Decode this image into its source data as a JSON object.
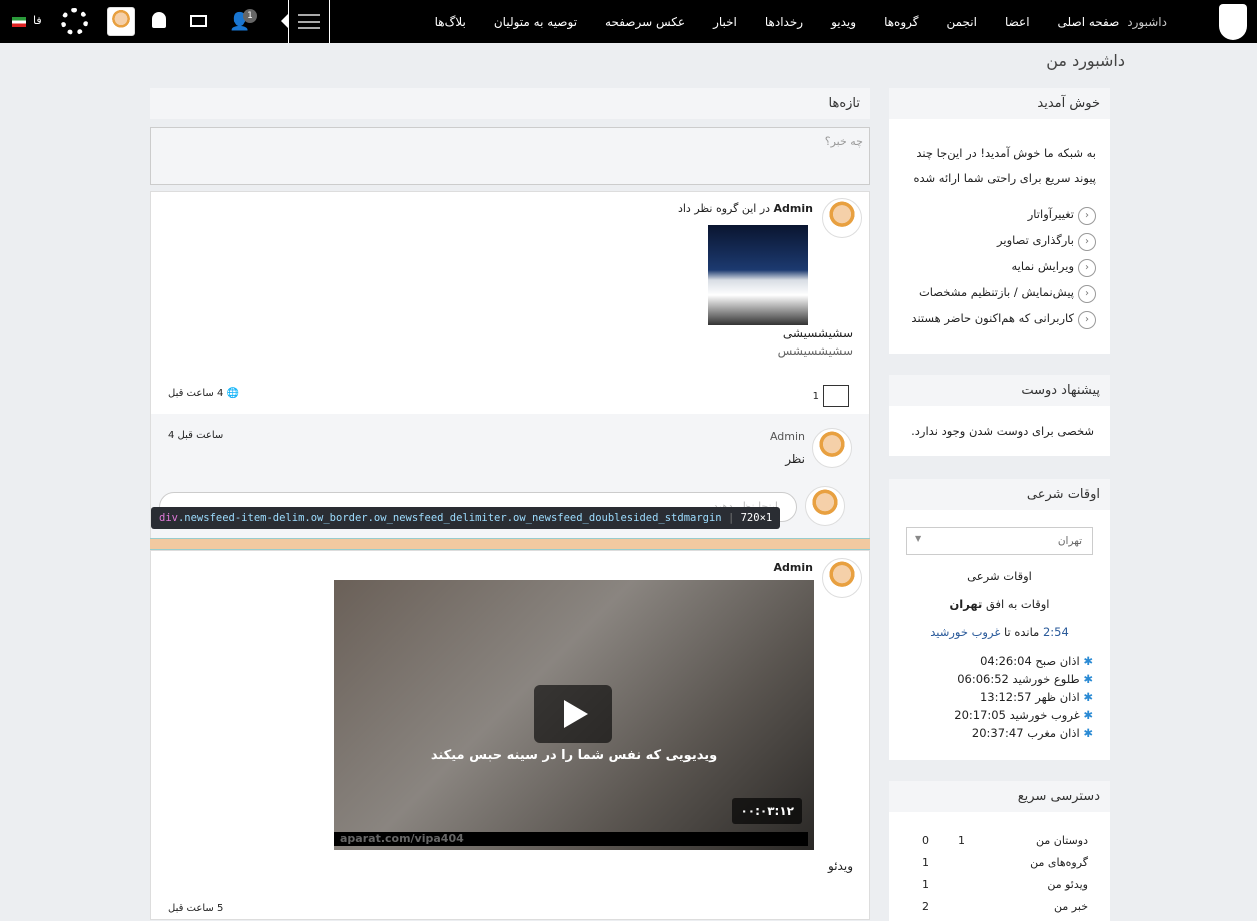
{
  "topbar": {
    "logo": "logo-icon",
    "nav": [
      "داشبورد",
      "صفحه اصلی",
      "اعضا",
      "انجمن",
      "گروه‌ها",
      "ویدیو",
      "رخدادها",
      "اخبار",
      "عکس سرصفحه",
      "توصیه به متولیان",
      "بلاگ‌ها"
    ],
    "friend_requests_count": "1",
    "lang": "فا"
  },
  "page_title": "داشبورد من",
  "feed": {
    "header": "تازه‌ها",
    "status_placeholder": "چه خبر؟",
    "post1": {
      "author": "Admin",
      "action": "در این گروه نظر داد",
      "line1": "سشیشسیشی",
      "line2": "سشیشسیشس",
      "comment_count": "1",
      "time": "4 ساعت قبل",
      "comment": {
        "author": "Admin",
        "text": "نظر",
        "time": "4 ساعت قبل"
      },
      "comment_placeholder": "اینجا نظر دهید"
    },
    "devtools_tooltip": {
      "tag": "div",
      "classes": ".newsfeed-item-delim.ow_border.ow_newsfeed_delimiter.ow_newsfeed_doublesided_stdmargin",
      "size": "720×1"
    },
    "post2": {
      "author": "Admin",
      "video_caption": "ویدیویی که نفس شما را در سینه حبس میکند",
      "duration": "۰۰:۰۳:۱۲",
      "watermark": "aparat.com/vipa404",
      "text": "ویدئو",
      "time": "5 ساعت قبل"
    }
  },
  "sidebar": {
    "welcome": {
      "title": "خوش آمدید",
      "text": "به شبکه ما خوش آمدید! در این‌جا چند پیوند سریع برای راحتی شما ارائه شده",
      "links": [
        "تغییرآواتار",
        "بارگذاری تصاویر",
        "ویرایش نمایه",
        "پیش‌نمایش / بازتنظیم مشخصات",
        "کاربرانی که هم‌اکنون حاضر هستند"
      ]
    },
    "friends": {
      "title": "پیشنهاد دوست",
      "empty": "شخصی برای دوست شدن وجود ندارد."
    },
    "prayer": {
      "title": "اوقات شرعی",
      "city": "تهران",
      "heading": "اوقات شرعی",
      "horizon_prefix": "اوقات به افق",
      "horizon_city": "تهران",
      "remaining_time": "2:54",
      "remaining_mid": "مانده تا",
      "remaining_event": "غروب خورشید",
      "times": [
        {
          "label": "اذان صبح",
          "time": "04:26:04"
        },
        {
          "label": "طلوع خورشید",
          "time": "06:06:52"
        },
        {
          "label": "اذان ظهر",
          "time": "13:12:57"
        },
        {
          "label": "غروب خورشید",
          "time": "20:17:05"
        },
        {
          "label": "اذان مغرب",
          "time": "20:37:47"
        }
      ]
    },
    "quick": {
      "title": "دسترسی سریع",
      "rows": [
        {
          "label": "دوستان من",
          "a": "1",
          "b": "0"
        },
        {
          "label": "گروه‌های من",
          "a": "",
          "b": "1"
        },
        {
          "label": "ویدئو من",
          "a": "",
          "b": "1"
        },
        {
          "label": "خبر من",
          "a": "",
          "b": "2"
        }
      ]
    }
  }
}
